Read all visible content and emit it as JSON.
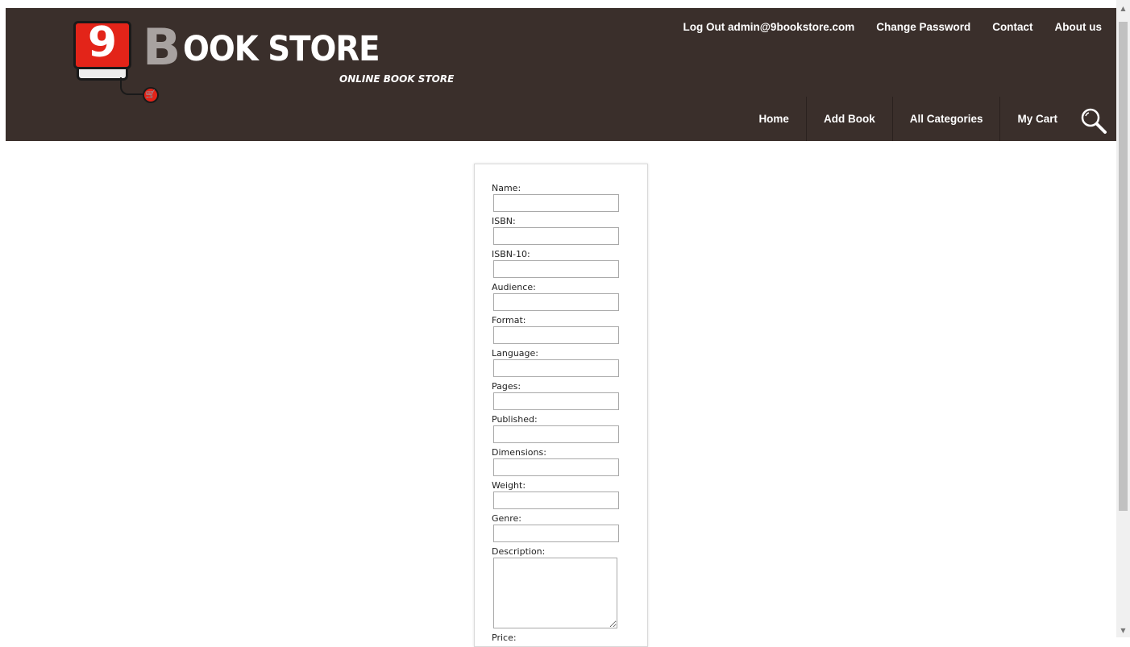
{
  "brand": {
    "nine": "9",
    "b_letter": "B",
    "title_rest": "OOK STORE",
    "tagline": "ONLINE BOOK STORE"
  },
  "top_links": [
    {
      "label": "Log Out admin@9bookstore.com"
    },
    {
      "label": "Change Password"
    },
    {
      "label": "Contact"
    },
    {
      "label": "About us"
    }
  ],
  "main_nav": [
    {
      "label": "Home"
    },
    {
      "label": "Add Book"
    },
    {
      "label": "All Categories"
    },
    {
      "label": "My Cart"
    }
  ],
  "icons": {
    "search": "search-icon",
    "cart": "cart-icon"
  },
  "form": {
    "fields": [
      {
        "label": "Name:",
        "value": ""
      },
      {
        "label": "ISBN:",
        "value": ""
      },
      {
        "label": "ISBN-10:",
        "value": ""
      },
      {
        "label": "Audience:",
        "value": ""
      },
      {
        "label": "Format:",
        "value": ""
      },
      {
        "label": "Language:",
        "value": ""
      },
      {
        "label": "Pages:",
        "value": ""
      },
      {
        "label": "Published:",
        "value": ""
      },
      {
        "label": "Dimensions:",
        "value": ""
      },
      {
        "label": "Weight:",
        "value": ""
      },
      {
        "label": "Genre:",
        "value": ""
      }
    ],
    "description": {
      "label": "Description:",
      "value": ""
    },
    "price": {
      "label": "Price:"
    }
  },
  "colors": {
    "header_bg": "#3a2f2b",
    "brand_red": "#e32419",
    "brand_grey": "#a8a2a0"
  }
}
